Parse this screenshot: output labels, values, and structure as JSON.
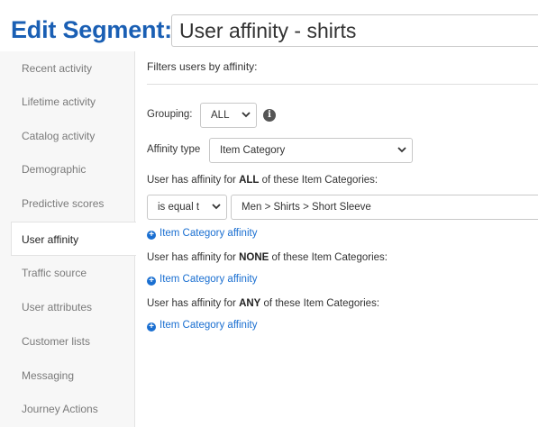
{
  "header": {
    "title": "Edit Segment:",
    "segment_name": "User affinity - shirts"
  },
  "sidebar": {
    "items": [
      {
        "label": "Recent activity"
      },
      {
        "label": "Lifetime activity"
      },
      {
        "label": "Catalog activity"
      },
      {
        "label": "Demographic"
      },
      {
        "label": "Predictive scores"
      },
      {
        "label": "User affinity",
        "active": true
      },
      {
        "label": "Traffic source"
      },
      {
        "label": "User attributes"
      },
      {
        "label": "Customer lists"
      },
      {
        "label": "Messaging"
      },
      {
        "label": "Journey Actions"
      }
    ]
  },
  "main": {
    "heading": "Filters users by affinity:",
    "grouping": {
      "label": "Grouping:",
      "value": "ALL",
      "info_icon": "info-circle-icon"
    },
    "affinity_type": {
      "label": "Affinity type",
      "value": "Item Category"
    },
    "all_section": {
      "prefix": "User has affinity for ",
      "keyword": "ALL",
      "suffix": " of these Item Categories:",
      "operator": "is equal t",
      "value": "Men > Shirts > Short Sleeve",
      "add_link": "Item Category affinity"
    },
    "none_section": {
      "prefix": "User has affinity for ",
      "keyword": "NONE",
      "suffix": " of these Item Categories:",
      "add_link": "Item Category affinity"
    },
    "any_section": {
      "prefix": "User has affinity for ",
      "keyword": "ANY",
      "suffix": " of these Item Categories:",
      "add_link": "Item Category affinity"
    }
  },
  "colors": {
    "accent": "#1a5fb4",
    "link": "#1a6fd1"
  }
}
